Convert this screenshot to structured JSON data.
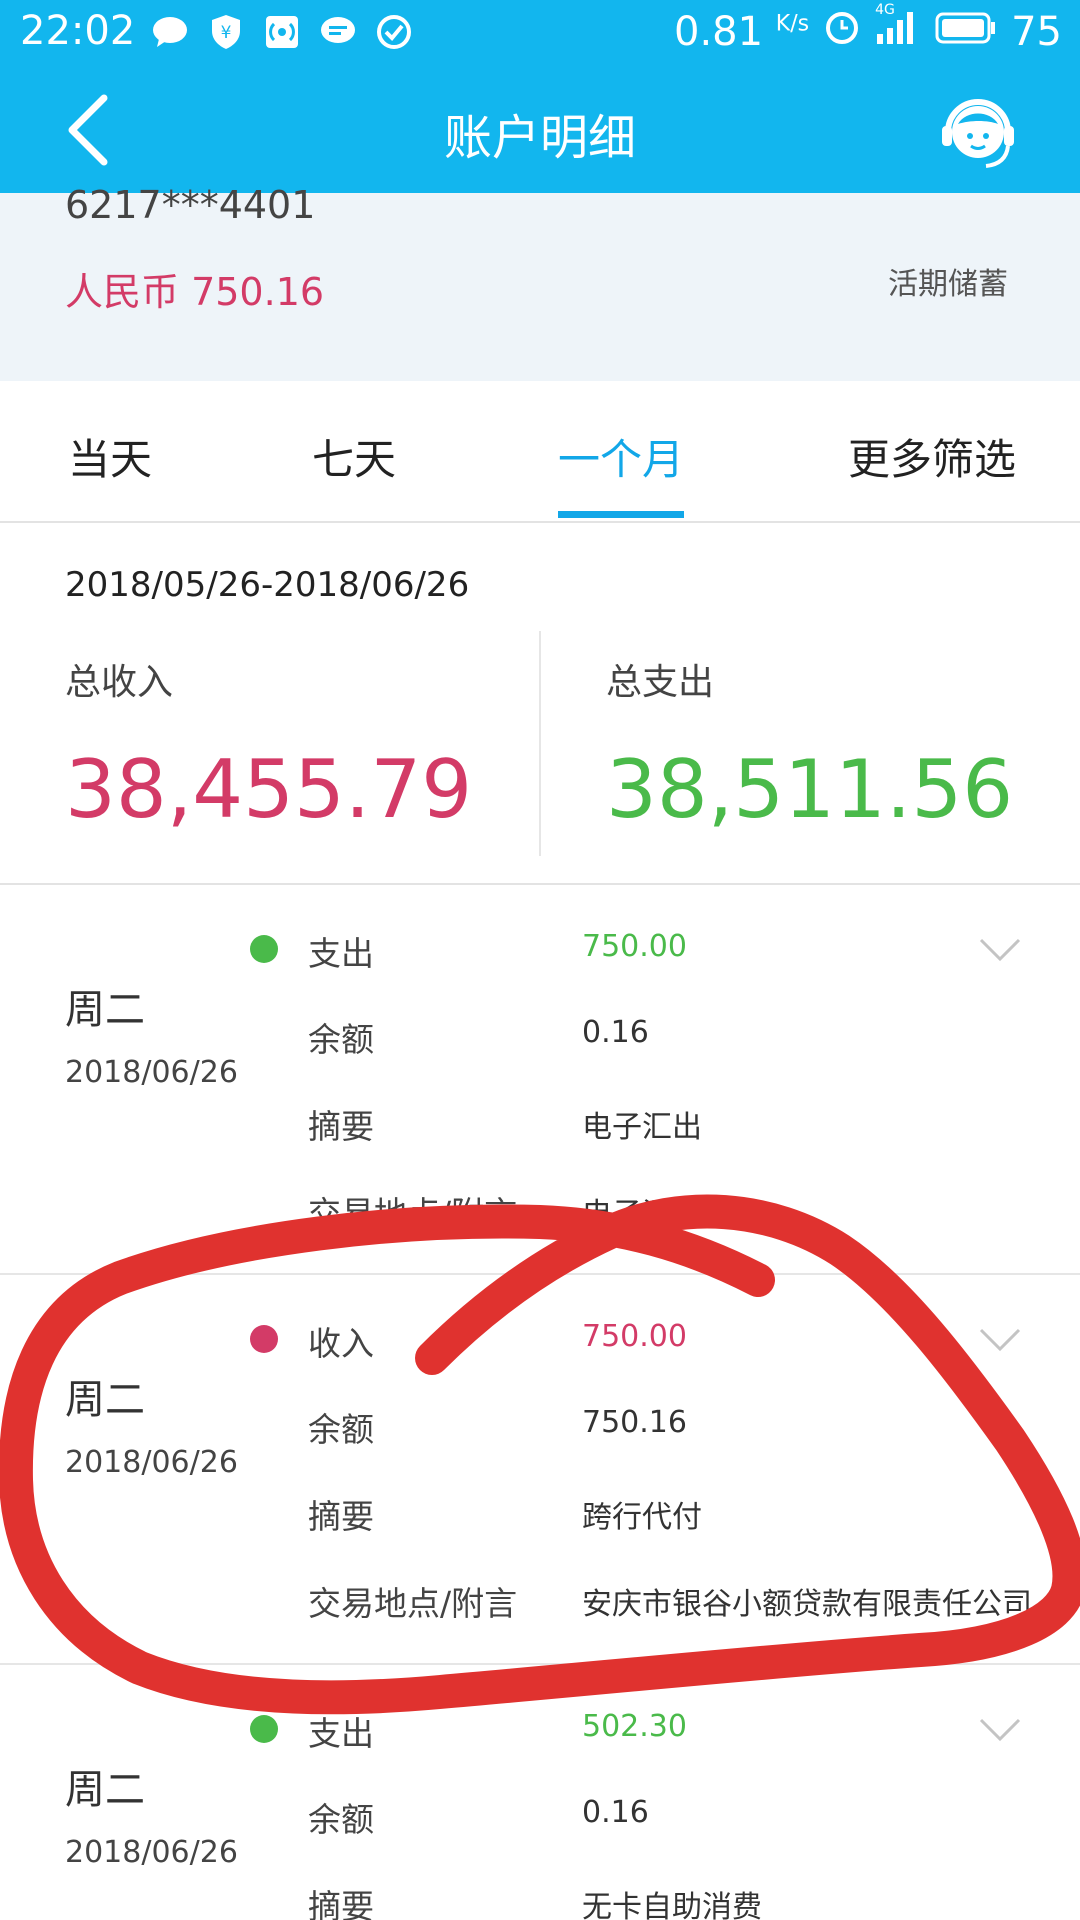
{
  "status_bar": {
    "time": "22:02",
    "net_speed": "0.81",
    "net_unit": "K/s",
    "network": "4G",
    "battery": "75"
  },
  "header": {
    "title": "账户明细"
  },
  "account": {
    "number": "6217***4401",
    "balance": "人民币 750.16",
    "type": "活期储蓄"
  },
  "tabs": [
    {
      "label": "当天"
    },
    {
      "label": "七天"
    },
    {
      "label": "一个月"
    },
    {
      "label": "更多筛选"
    }
  ],
  "summary": {
    "date_range": "2018/05/26-2018/06/26",
    "income_label": "总收入",
    "income_value": "38,455.79",
    "expense_label": "总支出",
    "expense_value": "38,511.56"
  },
  "transactions": [
    {
      "weekday": "周二",
      "date": "2018/06/26",
      "rows": [
        {
          "label": "支出",
          "value": "750.00"
        },
        {
          "label": "余额",
          "value": "0.16"
        },
        {
          "label": "摘要",
          "value": "电子汇出"
        },
        {
          "label": "交易地点/附言",
          "value": "电子汇出"
        }
      ]
    },
    {
      "weekday": "周二",
      "date": "2018/06/26",
      "rows": [
        {
          "label": "收入",
          "value": "750.00"
        },
        {
          "label": "余额",
          "value": "750.16"
        },
        {
          "label": "摘要",
          "value": "跨行代付"
        },
        {
          "label": "交易地点/附言",
          "value": "安庆市银谷小额贷款有限责任公司"
        }
      ]
    },
    {
      "weekday": "周二",
      "date": "2018/06/26",
      "rows": [
        {
          "label": "支出",
          "value": "502.30"
        },
        {
          "label": "余额",
          "value": "0.16"
        },
        {
          "label": "摘要",
          "value": "无卡自助消费"
        }
      ]
    }
  ],
  "colors": {
    "primary": "#12b6ee",
    "income": "#d33b67",
    "expense": "#4aba4a",
    "annotation": "#e0322f"
  }
}
